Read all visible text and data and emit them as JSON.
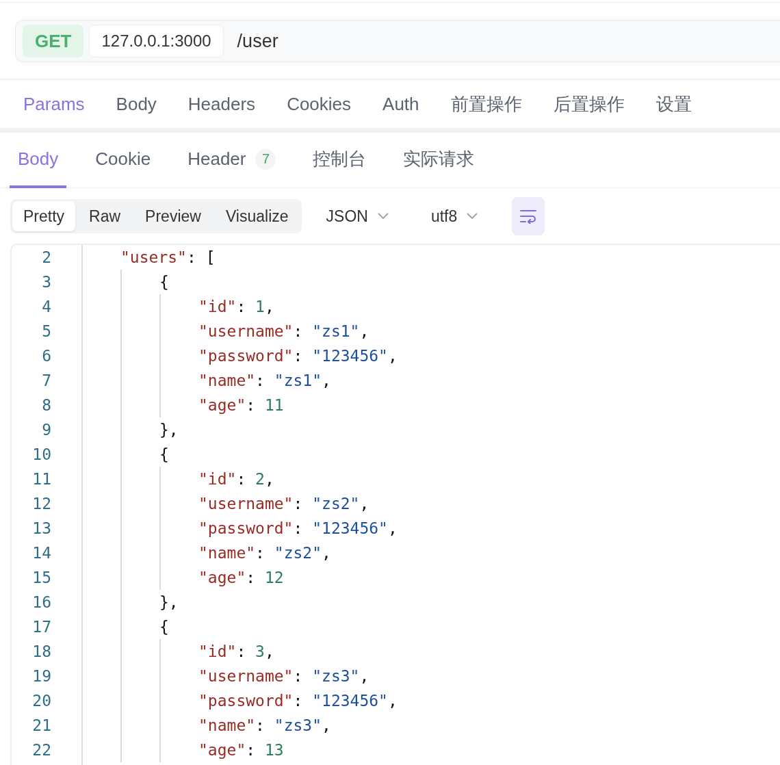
{
  "url_bar": {
    "method": "GET",
    "host": "127.0.0.1:3000",
    "path": "/user"
  },
  "request_tabs": [
    {
      "label": "Params",
      "selected": true
    },
    {
      "label": "Body",
      "selected": false
    },
    {
      "label": "Headers",
      "selected": false
    },
    {
      "label": "Cookies",
      "selected": false
    },
    {
      "label": "Auth",
      "selected": false
    },
    {
      "label": "前置操作",
      "selected": false
    },
    {
      "label": "后置操作",
      "selected": false
    },
    {
      "label": "设置",
      "selected": false
    }
  ],
  "response_tabs": [
    {
      "label": "Body",
      "selected": true
    },
    {
      "label": "Cookie",
      "selected": false
    },
    {
      "label": "Header",
      "selected": false,
      "badge": "7"
    },
    {
      "label": "控制台",
      "selected": false
    },
    {
      "label": "实际请求",
      "selected": false
    }
  ],
  "view_modes": [
    {
      "label": "Pretty",
      "selected": true
    },
    {
      "label": "Raw",
      "selected": false
    },
    {
      "label": "Preview",
      "selected": false
    },
    {
      "label": "Visualize",
      "selected": false
    }
  ],
  "format_select": {
    "value": "JSON"
  },
  "encoding_select": {
    "value": "utf8"
  },
  "editor": {
    "lines": [
      {
        "number": "2",
        "tokens": [
          {
            "kind": "key",
            "text": "\"users\""
          },
          {
            "kind": "punct",
            "text": ": ["
          }
        ],
        "children": [
          {
            "number": "3",
            "tokens": [
              {
                "kind": "punct",
                "text": "{"
              }
            ],
            "children": [
              {
                "number": "4",
                "tokens": [
                  {
                    "kind": "key",
                    "text": "\"id\""
                  },
                  {
                    "kind": "punct",
                    "text": ": "
                  },
                  {
                    "kind": "number",
                    "text": "1"
                  },
                  {
                    "kind": "punct",
                    "text": ","
                  }
                ]
              },
              {
                "number": "5",
                "tokens": [
                  {
                    "kind": "key",
                    "text": "\"username\""
                  },
                  {
                    "kind": "punct",
                    "text": ": "
                  },
                  {
                    "kind": "string",
                    "text": "\"zs1\""
                  },
                  {
                    "kind": "punct",
                    "text": ","
                  }
                ]
              },
              {
                "number": "6",
                "tokens": [
                  {
                    "kind": "key",
                    "text": "\"password\""
                  },
                  {
                    "kind": "punct",
                    "text": ": "
                  },
                  {
                    "kind": "string",
                    "text": "\"123456\""
                  },
                  {
                    "kind": "punct",
                    "text": ","
                  }
                ]
              },
              {
                "number": "7",
                "tokens": [
                  {
                    "kind": "key",
                    "text": "\"name\""
                  },
                  {
                    "kind": "punct",
                    "text": ": "
                  },
                  {
                    "kind": "string",
                    "text": "\"zs1\""
                  },
                  {
                    "kind": "punct",
                    "text": ","
                  }
                ]
              },
              {
                "number": "8",
                "tokens": [
                  {
                    "kind": "key",
                    "text": "\"age\""
                  },
                  {
                    "kind": "punct",
                    "text": ": "
                  },
                  {
                    "kind": "number",
                    "text": "11"
                  }
                ]
              }
            ]
          },
          {
            "number": "9",
            "tokens": [
              {
                "kind": "punct",
                "text": "},"
              }
            ]
          },
          {
            "number": "10",
            "tokens": [
              {
                "kind": "punct",
                "text": "{"
              }
            ],
            "children": [
              {
                "number": "11",
                "tokens": [
                  {
                    "kind": "key",
                    "text": "\"id\""
                  },
                  {
                    "kind": "punct",
                    "text": ": "
                  },
                  {
                    "kind": "number",
                    "text": "2"
                  },
                  {
                    "kind": "punct",
                    "text": ","
                  }
                ]
              },
              {
                "number": "12",
                "tokens": [
                  {
                    "kind": "key",
                    "text": "\"username\""
                  },
                  {
                    "kind": "punct",
                    "text": ": "
                  },
                  {
                    "kind": "string",
                    "text": "\"zs2\""
                  },
                  {
                    "kind": "punct",
                    "text": ","
                  }
                ]
              },
              {
                "number": "13",
                "tokens": [
                  {
                    "kind": "key",
                    "text": "\"password\""
                  },
                  {
                    "kind": "punct",
                    "text": ": "
                  },
                  {
                    "kind": "string",
                    "text": "\"123456\""
                  },
                  {
                    "kind": "punct",
                    "text": ","
                  }
                ]
              },
              {
                "number": "14",
                "tokens": [
                  {
                    "kind": "key",
                    "text": "\"name\""
                  },
                  {
                    "kind": "punct",
                    "text": ": "
                  },
                  {
                    "kind": "string",
                    "text": "\"zs2\""
                  },
                  {
                    "kind": "punct",
                    "text": ","
                  }
                ]
              },
              {
                "number": "15",
                "tokens": [
                  {
                    "kind": "key",
                    "text": "\"age\""
                  },
                  {
                    "kind": "punct",
                    "text": ": "
                  },
                  {
                    "kind": "number",
                    "text": "12"
                  }
                ]
              }
            ]
          },
          {
            "number": "16",
            "tokens": [
              {
                "kind": "punct",
                "text": "},"
              }
            ]
          },
          {
            "number": "17",
            "tokens": [
              {
                "kind": "punct",
                "text": "{"
              }
            ],
            "children": [
              {
                "number": "18",
                "tokens": [
                  {
                    "kind": "key",
                    "text": "\"id\""
                  },
                  {
                    "kind": "punct",
                    "text": ": "
                  },
                  {
                    "kind": "number",
                    "text": "3"
                  },
                  {
                    "kind": "punct",
                    "text": ","
                  }
                ]
              },
              {
                "number": "19",
                "tokens": [
                  {
                    "kind": "key",
                    "text": "\"username\""
                  },
                  {
                    "kind": "punct",
                    "text": ": "
                  },
                  {
                    "kind": "string",
                    "text": "\"zs3\""
                  },
                  {
                    "kind": "punct",
                    "text": ","
                  }
                ]
              },
              {
                "number": "20",
                "tokens": [
                  {
                    "kind": "key",
                    "text": "\"password\""
                  },
                  {
                    "kind": "punct",
                    "text": ": "
                  },
                  {
                    "kind": "string",
                    "text": "\"123456\""
                  },
                  {
                    "kind": "punct",
                    "text": ","
                  }
                ]
              },
              {
                "number": "21",
                "tokens": [
                  {
                    "kind": "key",
                    "text": "\"name\""
                  },
                  {
                    "kind": "punct",
                    "text": ": "
                  },
                  {
                    "kind": "string",
                    "text": "\"zs3\""
                  },
                  {
                    "kind": "punct",
                    "text": ","
                  }
                ]
              },
              {
                "number": "22",
                "tokens": [
                  {
                    "kind": "key",
                    "text": "\"age\""
                  },
                  {
                    "kind": "punct",
                    "text": ": "
                  },
                  {
                    "kind": "number",
                    "text": "13"
                  }
                ]
              }
            ]
          }
        ]
      }
    ]
  }
}
